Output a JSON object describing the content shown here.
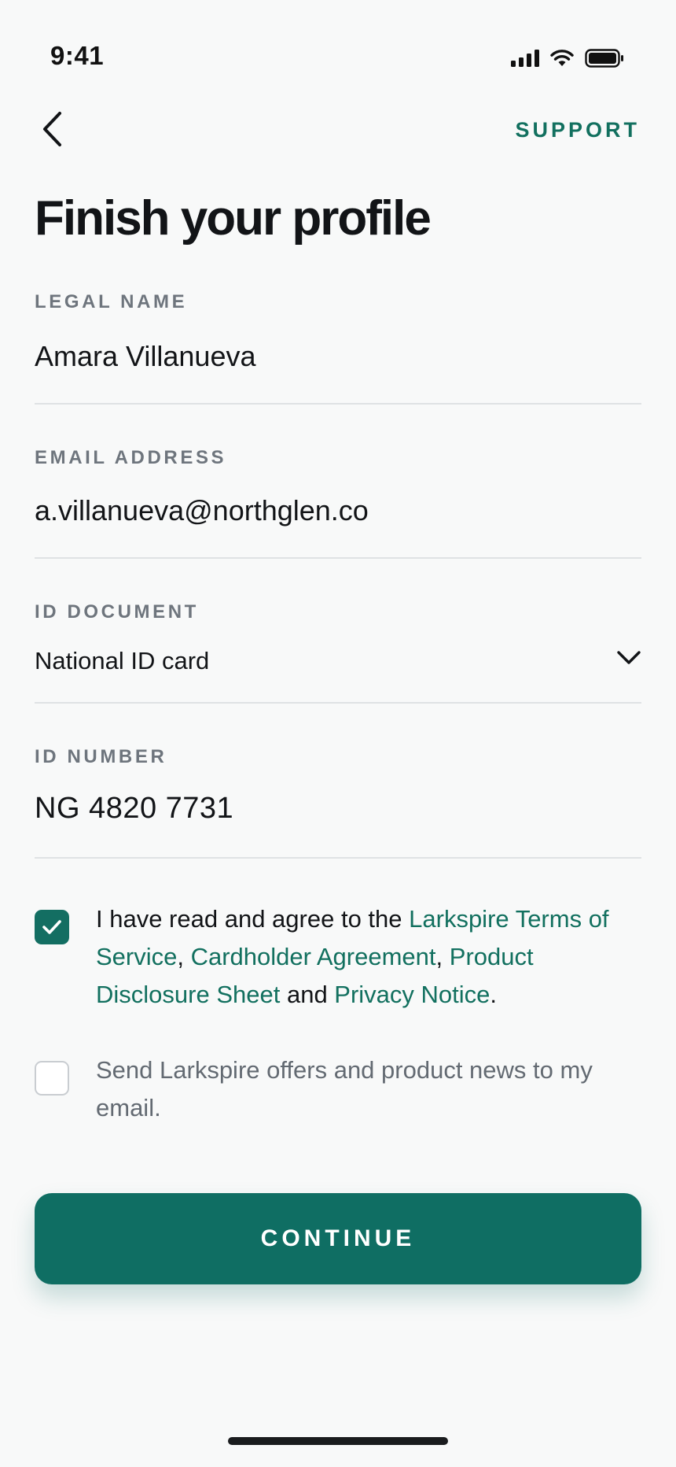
{
  "status_bar": {
    "time": "9:41",
    "icons": [
      "cellular-signal-icon",
      "wifi-icon",
      "battery-icon"
    ]
  },
  "nav": {
    "back_icon": "chevron-left-icon",
    "support_label": "SUPPORT"
  },
  "title": "Finish your profile",
  "fields": {
    "legal_name": {
      "label": "LEGAL NAME",
      "value": "Amara Villanueva"
    },
    "email": {
      "label": "EMAIL ADDRESS",
      "value": "a.villanueva@northglen.co"
    },
    "id_document": {
      "label": "ID DOCUMENT",
      "value": "National ID card",
      "icon": "chevron-down-icon"
    },
    "id_number": {
      "label": "ID NUMBER",
      "value": "NG 4820 7731"
    }
  },
  "consents": {
    "terms": {
      "checked": true,
      "text_before": "I have read and agree to the ",
      "link_terms": "Larkspire Terms of Service",
      "sep1": ", ",
      "link_cardholder": "Cardholder Agreement",
      "sep2": ", ",
      "link_disclosure": "Product Disclosure Sheet",
      "and": " and ",
      "link_privacy": "Privacy Notice",
      "end": "."
    },
    "marketing": {
      "checked": false,
      "text": "Send Larkspire offers and product news to my email."
    }
  },
  "continue_label": "CONTINUE",
  "colors": {
    "accent": "#12705f",
    "button": "#0f6e63",
    "label": "#6e757d",
    "background": "#f8f9f9"
  }
}
